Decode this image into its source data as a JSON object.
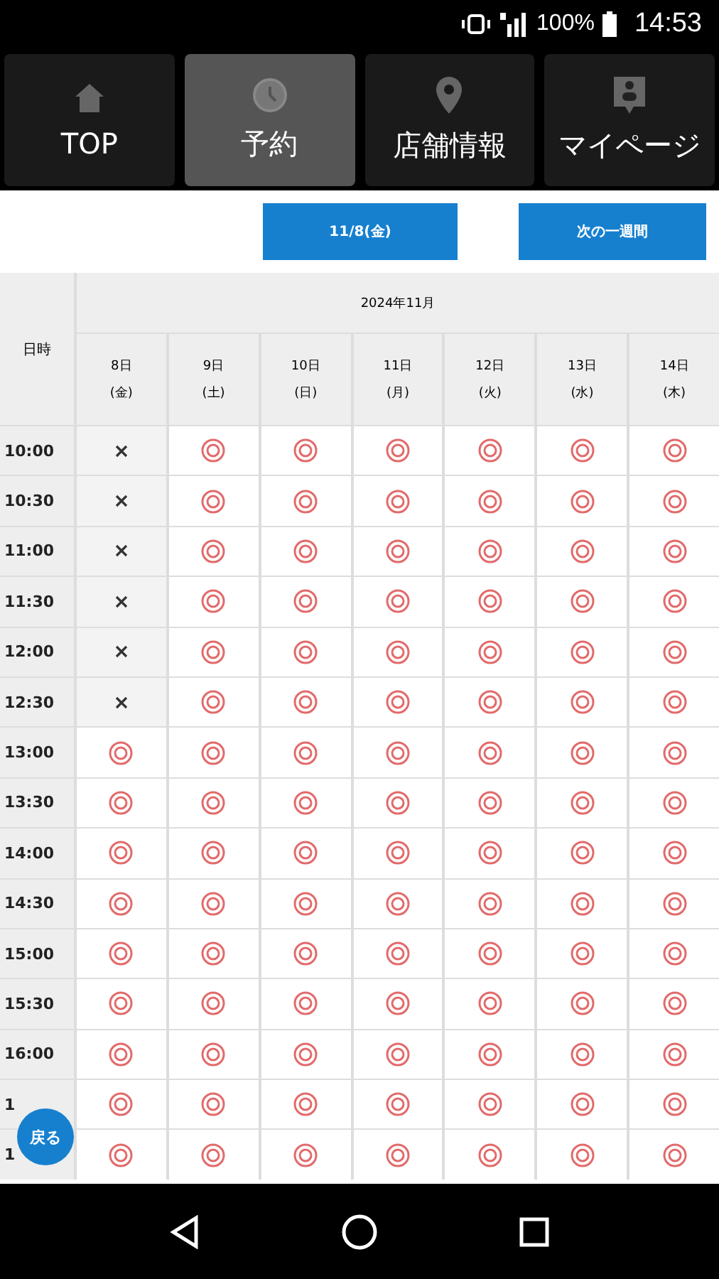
{
  "status_bar": {
    "battery_text": "100%",
    "time": "14:53"
  },
  "tabs": [
    {
      "label": "TOP",
      "selected": false
    },
    {
      "label": "予約",
      "selected": true
    },
    {
      "label": "店舗情報",
      "selected": false
    },
    {
      "label": "マイページ",
      "selected": false
    }
  ],
  "toolbar": {
    "buttons": [
      "11/8(金)",
      "次の一週間"
    ]
  },
  "table": {
    "corner": "日時",
    "month": "2024年11月",
    "days": [
      {
        "date": "8日",
        "weekday": "(金)"
      },
      {
        "date": "9日",
        "weekday": "(土)"
      },
      {
        "date": "10日",
        "weekday": "(日)"
      },
      {
        "date": "11日",
        "weekday": "(月)"
      },
      {
        "date": "12日",
        "weekday": "(火)"
      },
      {
        "date": "13日",
        "weekday": "(水)"
      },
      {
        "date": "14日",
        "weekday": "(木)"
      }
    ],
    "rows": [
      {
        "time": "10:00",
        "slots": [
          false,
          true,
          true,
          true,
          true,
          true,
          true
        ]
      },
      {
        "time": "10:30",
        "slots": [
          false,
          true,
          true,
          true,
          true,
          true,
          true
        ]
      },
      {
        "time": "11:00",
        "slots": [
          false,
          true,
          true,
          true,
          true,
          true,
          true
        ]
      },
      {
        "time": "11:30",
        "slots": [
          false,
          true,
          true,
          true,
          true,
          true,
          true
        ]
      },
      {
        "time": "12:00",
        "slots": [
          false,
          true,
          true,
          true,
          true,
          true,
          true
        ]
      },
      {
        "time": "12:30",
        "slots": [
          false,
          true,
          true,
          true,
          true,
          true,
          true
        ]
      },
      {
        "time": "13:00",
        "slots": [
          true,
          true,
          true,
          true,
          true,
          true,
          true
        ]
      },
      {
        "time": "13:30",
        "slots": [
          true,
          true,
          true,
          true,
          true,
          true,
          true
        ]
      },
      {
        "time": "14:00",
        "slots": [
          true,
          true,
          true,
          true,
          true,
          true,
          true
        ]
      },
      {
        "time": "14:30",
        "slots": [
          true,
          true,
          true,
          true,
          true,
          true,
          true
        ]
      },
      {
        "time": "15:00",
        "slots": [
          true,
          true,
          true,
          true,
          true,
          true,
          true
        ]
      },
      {
        "time": "15:30",
        "slots": [
          true,
          true,
          true,
          true,
          true,
          true,
          true
        ]
      },
      {
        "time": "16:00",
        "slots": [
          true,
          true,
          true,
          true,
          true,
          true,
          true
        ]
      },
      {
        "time": "1",
        "slots": [
          true,
          true,
          true,
          true,
          true,
          true,
          true
        ]
      },
      {
        "time": "1",
        "slots": [
          true,
          true,
          true,
          true,
          true,
          true,
          true
        ]
      }
    ]
  },
  "back_button": "戻る"
}
